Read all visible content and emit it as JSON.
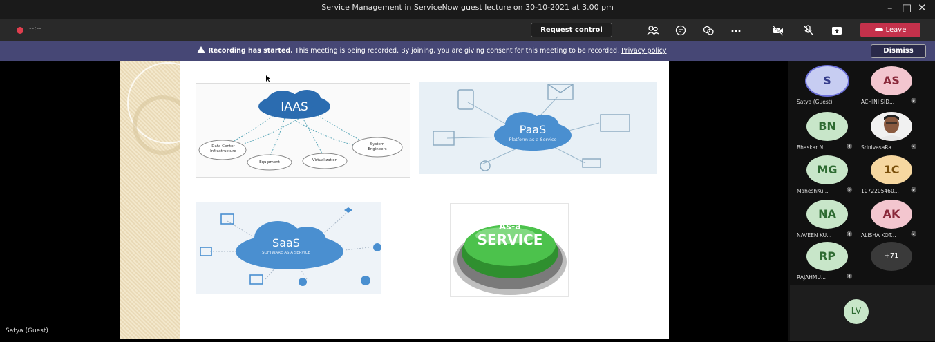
{
  "window": {
    "title": "Service Management in ServiceNow guest lecture on 30-10-2021 at 3.00 pm"
  },
  "toolbar": {
    "timer": "--:--",
    "request_control": "Request control",
    "leave": "Leave",
    "icons": [
      "participants-icon",
      "chat-icon",
      "reactions-icon",
      "more-icon",
      "camera-off-icon",
      "mic-off-icon",
      "share-icon",
      "phone-icon"
    ]
  },
  "banner": {
    "strong": "Recording has started.",
    "text": " This meeting is being recorded. By joining, you are giving consent for this meeting to be recorded. ",
    "link": "Privacy policy",
    "dismiss": "Dismiss"
  },
  "slide": {
    "iaas": {
      "cloud": "IAAS",
      "nodes": [
        "Data Center Infrastructure",
        "Equipment",
        "Virtualization",
        "System Engineers"
      ]
    },
    "paas": {
      "title": "PaaS",
      "sub": "Platform as a Service"
    },
    "saas": {
      "title": "SaaS",
      "sub": "SOFTWARE AS A SERVICE"
    },
    "button": {
      "line1": "As-a",
      "line2": "SERVICE"
    }
  },
  "presenter": "Satya (Guest)",
  "participants": [
    {
      "initials": "S",
      "name": "Satya (Guest)",
      "bg": "#c7cdf2",
      "fg": "#333a8a",
      "muted": false,
      "ring": true
    },
    {
      "initials": "AS",
      "name": "ACHINI SID...",
      "bg": "#f3c6cf",
      "fg": "#8a2a3b",
      "muted": true
    },
    {
      "initials": "BN",
      "name": "Bhaskar N",
      "bg": "#c8e6c9",
      "fg": "#2e6b32",
      "muted": true
    },
    {
      "initials": "",
      "name": "SrinivasaRa...",
      "bg": "#6b4a3a",
      "fg": "#fff",
      "muted": true,
      "photo": true
    },
    {
      "initials": "MG",
      "name": "MaheshKu...",
      "bg": "#c8e6c9",
      "fg": "#2e6b32",
      "muted": true
    },
    {
      "initials": "1C",
      "name": "1072205460...",
      "bg": "#f6d7a0",
      "fg": "#7a4f0a",
      "muted": true
    },
    {
      "initials": "NA",
      "name": "NAVEEN KU...",
      "bg": "#c8e6c9",
      "fg": "#2e6b32",
      "muted": true
    },
    {
      "initials": "AK",
      "name": "ALISHA KOT...",
      "bg": "#f3c6cf",
      "fg": "#8a2a3b",
      "muted": true
    },
    {
      "initials": "RP",
      "name": "RAJAHMU...",
      "bg": "#c8e6c9",
      "fg": "#2e6b32",
      "muted": true
    },
    {
      "initials": "+71",
      "name": "",
      "bg": "#3a3a3a",
      "fg": "#fff",
      "muted": false
    }
  ],
  "bottom_tile": {
    "initials": "LV",
    "bg": "#c8e6c9",
    "fg": "#2e6b32"
  }
}
